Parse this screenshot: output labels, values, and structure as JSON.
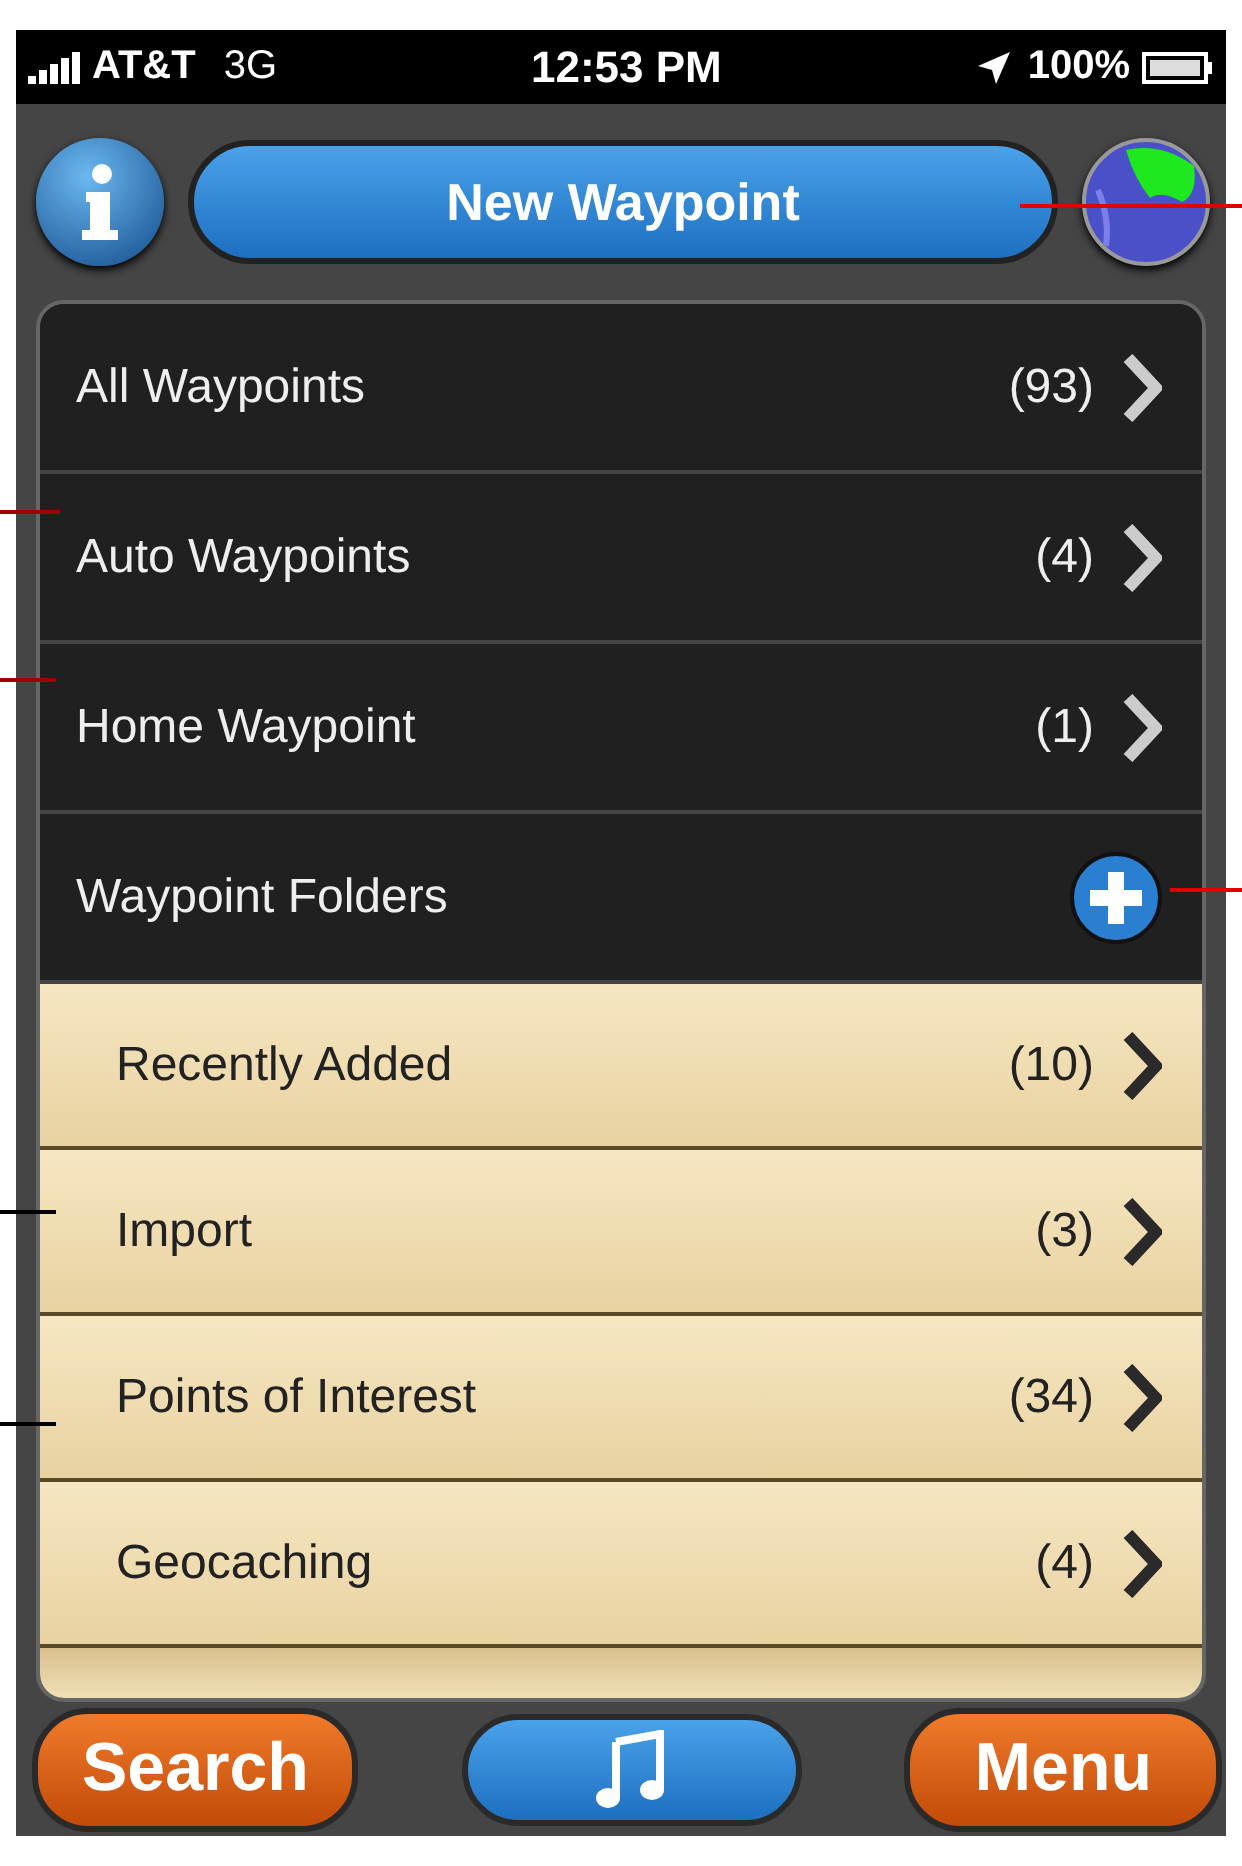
{
  "status_bar": {
    "carrier": "AT&T",
    "network": "3G",
    "time": "12:53 PM",
    "battery": "100%"
  },
  "header": {
    "button": "New Waypoint"
  },
  "menu": [
    {
      "kind": "item",
      "label": "All Waypoints",
      "count": "(93)"
    },
    {
      "kind": "item",
      "label": "Auto Waypoints",
      "count": "(4)"
    },
    {
      "kind": "item",
      "label": "Home Waypoint",
      "count": "(1)"
    },
    {
      "kind": "section",
      "label": "Waypoint Folders"
    }
  ],
  "folders": [
    {
      "label": "Recently Added",
      "count": "(10)"
    },
    {
      "label": "Import",
      "count": "(3)"
    },
    {
      "label": "Points of Interest",
      "count": "(34)"
    },
    {
      "label": "Geocaching",
      "count": "(4)"
    }
  ],
  "toolbar": {
    "left": "Search",
    "right": "Menu"
  },
  "leaders": [
    {
      "color": "#e00000"
    },
    {
      "color": "#a00000"
    },
    {
      "color": "#a00000"
    },
    {
      "color": "#e00000"
    },
    {
      "color": "#000000"
    },
    {
      "color": "#000000"
    }
  ]
}
